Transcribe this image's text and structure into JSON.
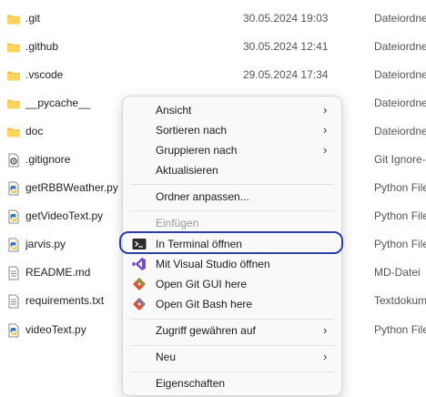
{
  "files": [
    {
      "name": ".git",
      "date": "30.05.2024 19:03",
      "type": "Dateiordne",
      "icon": "folder-icon"
    },
    {
      "name": ".github",
      "date": "30.05.2024 12:41",
      "type": "Dateiordne",
      "icon": "folder-icon"
    },
    {
      "name": ".vscode",
      "date": "29.05.2024 17:34",
      "type": "Dateiordne",
      "icon": "folder-icon"
    },
    {
      "name": "__pycache__",
      "date": "",
      "type": "Dateiordne",
      "icon": "folder-icon"
    },
    {
      "name": "doc",
      "date": "",
      "type": "Dateiordne",
      "icon": "folder-icon"
    },
    {
      "name": ".gitignore",
      "date": "",
      "type": "Git Ignore-",
      "icon": "gear-file-icon"
    },
    {
      "name": "getRBBWeather.py",
      "date": "",
      "type": "Python File",
      "icon": "python-file-icon"
    },
    {
      "name": "getVideoText.py",
      "date": "",
      "type": "Python File",
      "icon": "python-file-icon"
    },
    {
      "name": "jarvis.py",
      "date": "",
      "type": "Python File",
      "icon": "python-file-icon"
    },
    {
      "name": "README.md",
      "date": "",
      "type": "MD-Datei",
      "icon": "text-file-icon"
    },
    {
      "name": "requirements.txt",
      "date": "",
      "type": "Textdokum",
      "icon": "text-file-icon"
    },
    {
      "name": "videoText.py",
      "date": "",
      "type": "Python File",
      "icon": "python-file-icon"
    }
  ],
  "menu": {
    "view": "Ansicht",
    "sort_by": "Sortieren nach",
    "group_by": "Gruppieren nach",
    "refresh": "Aktualisieren",
    "customize": "Ordner anpassen...",
    "paste": "Einfügen",
    "open_terminal": "In Terminal öffnen",
    "open_vs": "Mit Visual Studio öffnen",
    "git_gui": "Open Git GUI here",
    "git_bash": "Open Git Bash here",
    "grant_access": "Zugriff gewähren auf",
    "new": "Neu",
    "properties": "Eigenschaften",
    "chevron": "›"
  },
  "colors": {
    "folder": "#f4c44e",
    "highlight_ring": "#2d3ea6",
    "python_blue": "#3b77a8",
    "python_yellow": "#f5c83d",
    "vs_purple": "#7b4fc4",
    "git_red": "#e84e31"
  }
}
